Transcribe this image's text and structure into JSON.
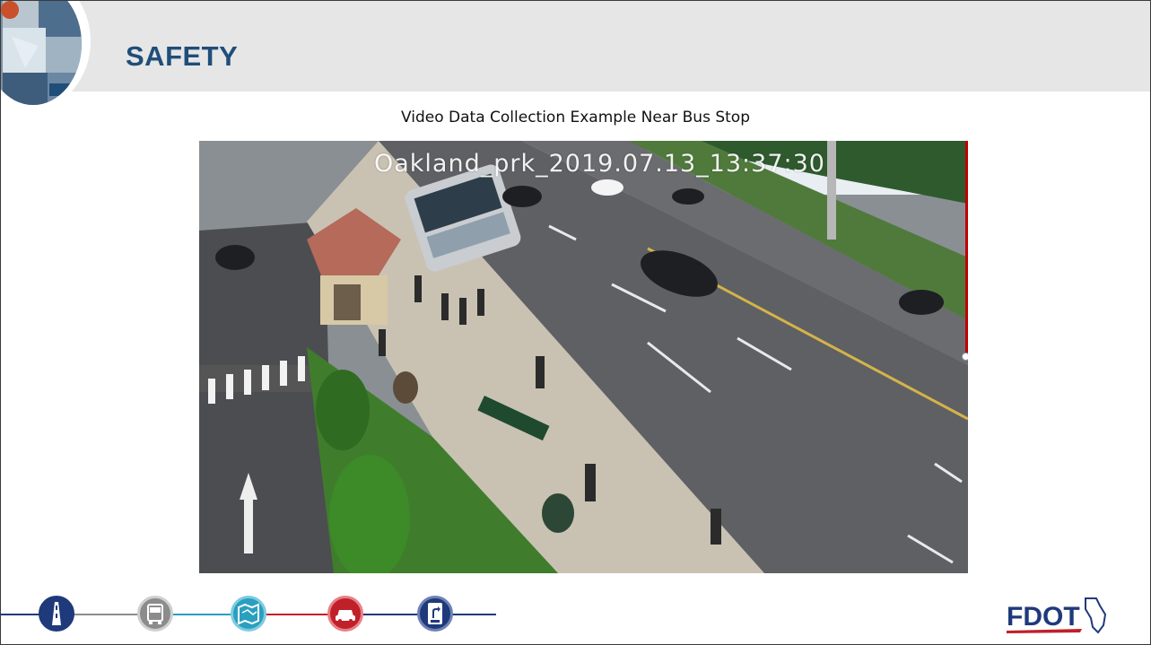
{
  "slide": {
    "title": "SAFETY",
    "subtitle": "Video Data Collection Example Near Bus Stop"
  },
  "video": {
    "overlay_label": "Oakland_prk_2019.07.13_13:37:30"
  },
  "footer": {
    "icons": [
      "highway-icon",
      "truck-icon",
      "map-icon",
      "car-icon",
      "turn-only-sign-icon"
    ],
    "icon_colors": [
      "#1f3a7a",
      "#8c8c8c",
      "#2a9fbf",
      "#c0202a",
      "#1f3a7a"
    ],
    "logo_text": "FDOT"
  }
}
